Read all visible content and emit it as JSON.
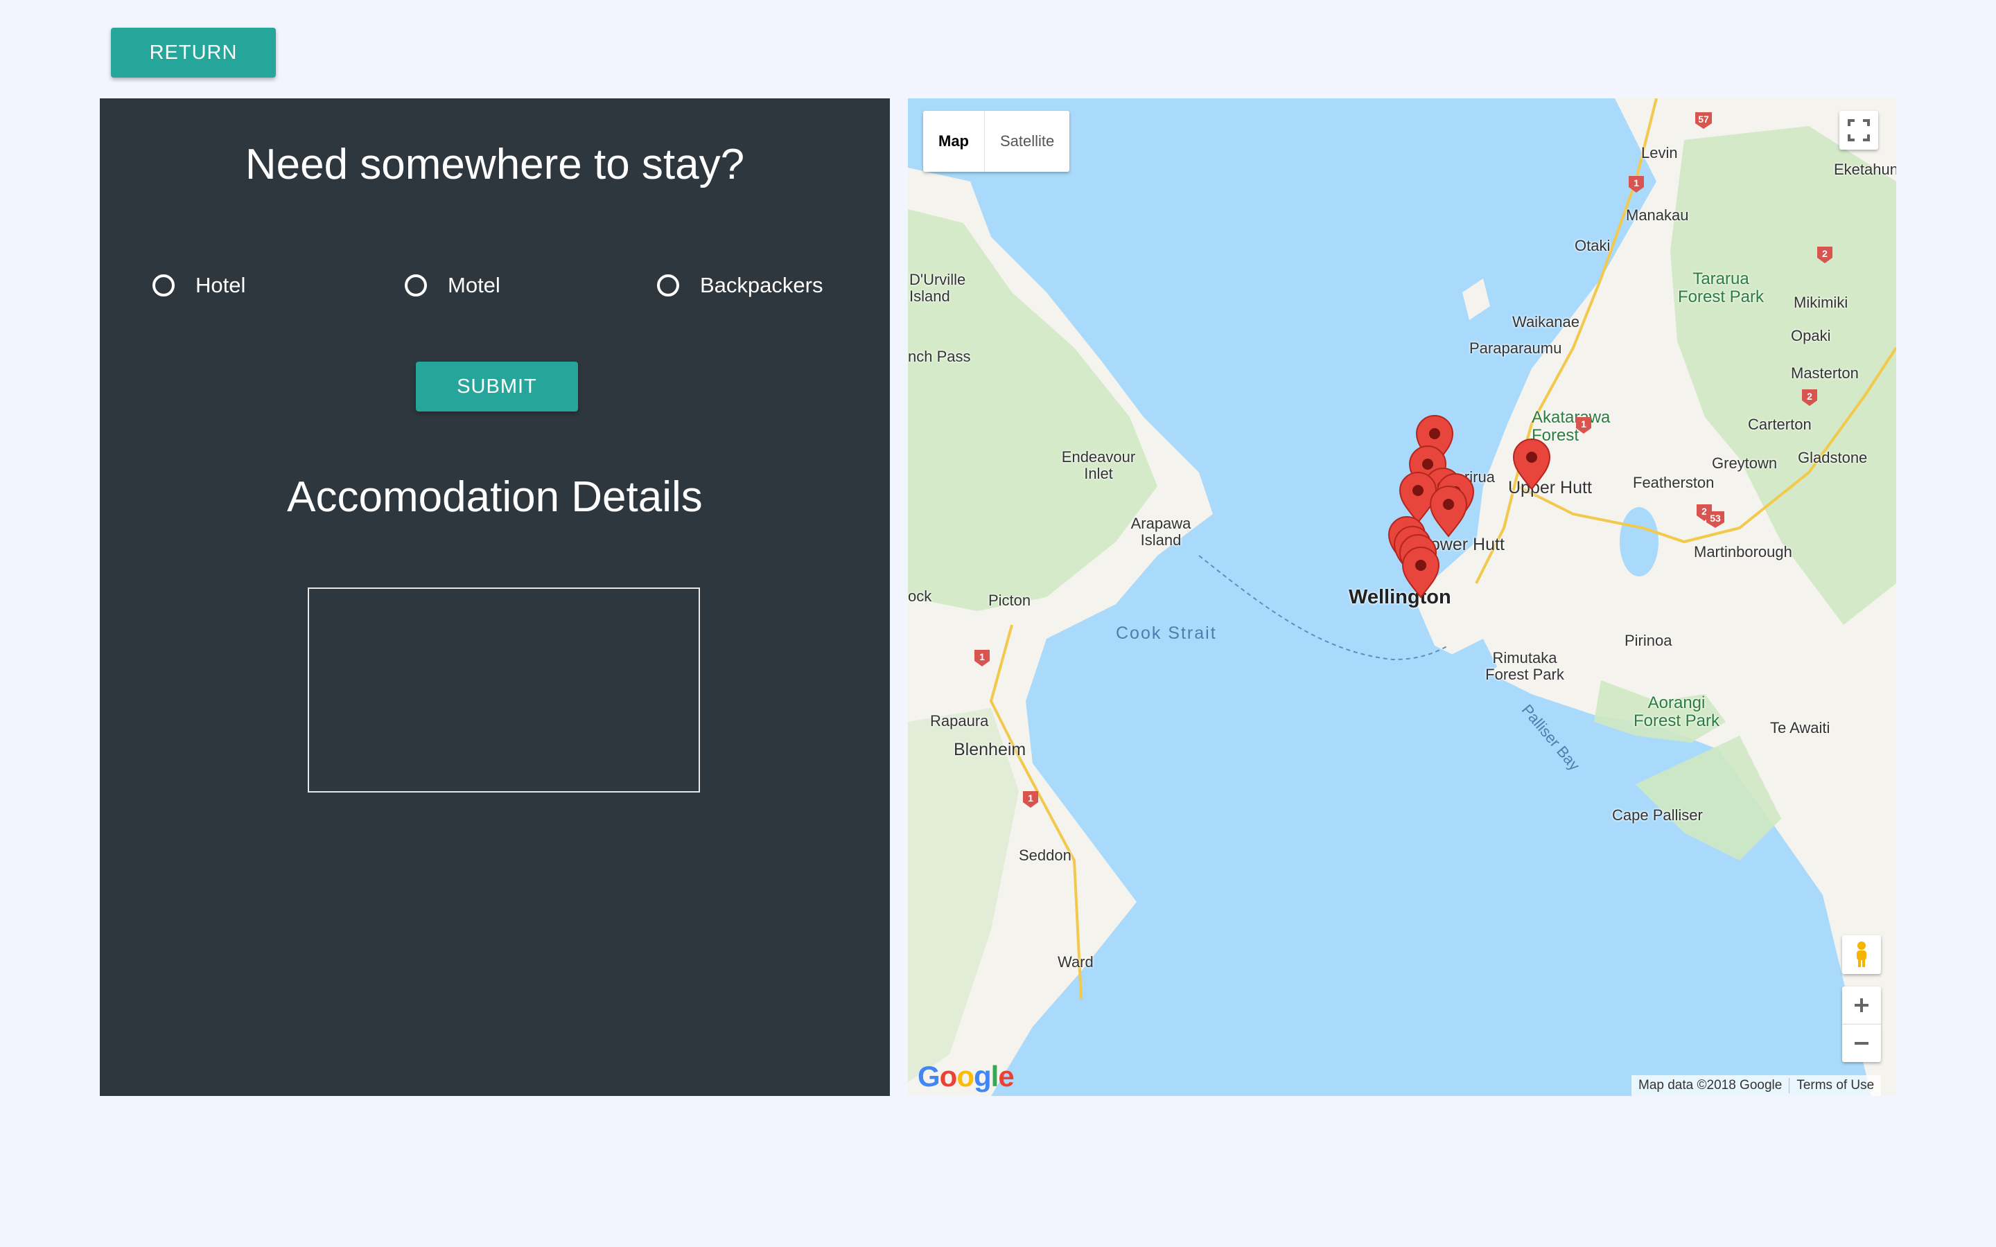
{
  "return_label": "RETURN",
  "form": {
    "title": "Need somewhere to stay?",
    "options": [
      "Hotel",
      "Motel",
      "Backpackers"
    ],
    "submit_label": "SUBMIT",
    "details_title": "Accomodation Details"
  },
  "map": {
    "type_options": [
      "Map",
      "Satellite"
    ],
    "selected_type": "Map",
    "places": [
      "Levin",
      "Eketahuna",
      "Manakau",
      "Otaki",
      "D'Urville Island",
      "Tararua Forest Park",
      "Mikimiki",
      "Waikanae",
      "Opaki",
      "nch Pass",
      "Paraparaumu",
      "Masterton",
      "Akatarawa Forest",
      "Carterton",
      "Endeavour Inlet",
      "Porirua",
      "Greytown",
      "Gladstone",
      "Upper Hutt",
      "Featherston",
      "Arapawa Island",
      "Lower Hutt",
      "Martinborough",
      "ock",
      "Picton",
      "Wellington",
      "Cook Strait",
      "Pirinoa",
      "Rimutaka Forest Park",
      "Rapaura",
      "Blenheim",
      "Palliser Bay",
      "Aorangi Forest Park",
      "Te Awaiti",
      "Cape Palliser",
      "Seddon",
      "Ward"
    ],
    "road_shields": [
      "57",
      "1",
      "2",
      "1",
      "2",
      "2",
      "53",
      "1",
      "1"
    ],
    "google_logo": "Google",
    "attribution": "Map data ©2018 Google",
    "terms": "Terms of Use",
    "marker_color": "#e8453c"
  },
  "colors": {
    "accent": "#26a69a",
    "panel": "#2e373e",
    "background": "#f2f5fd",
    "water": "#aadafb",
    "land": "#f5f3ee",
    "park": "#cfe8c2"
  }
}
